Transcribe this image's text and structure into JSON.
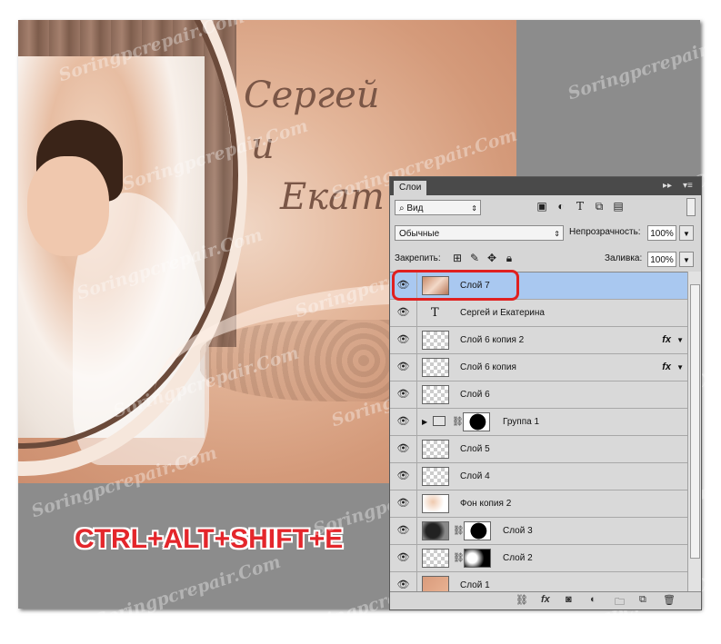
{
  "artwork": {
    "names_line1": "Сергей",
    "names_line2": "и",
    "names_line3": "Екат",
    "shortcut_caption": "CTRL+ALT+SHIFT+E",
    "watermark": "Soringpcrepair.Com"
  },
  "panel": {
    "tab_label": "Слои",
    "collapse_glyph": "▸▸",
    "menu_glyph": "▾≡",
    "filter_kind": "Вид",
    "blend_mode": "Обычные",
    "opacity_label": "Непрозрачность:",
    "opacity_value": "100%",
    "lock_label": "Закрепить:",
    "fill_label": "Заливка:",
    "fill_value": "100%",
    "fx_label": "fx"
  },
  "layers": [
    {
      "name": "Слой 7",
      "thumb": "photo",
      "selected": true
    },
    {
      "name": "Сергей и Екатерина",
      "type": "text"
    },
    {
      "name": "Слой 6 копия 2",
      "thumb": "transparent",
      "fx": true
    },
    {
      "name": "Слой 6 копия",
      "thumb": "transparent",
      "fx": true
    },
    {
      "name": "Слой 6",
      "thumb": "transparent"
    },
    {
      "name": "Группа 1",
      "type": "group",
      "mask": "black"
    },
    {
      "name": "Слой 5",
      "thumb": "transparent"
    },
    {
      "name": "Слой 4",
      "thumb": "transparent"
    },
    {
      "name": "Фон копия 2",
      "thumb": "bride"
    },
    {
      "name": "Слой 3",
      "thumb": "dark",
      "mask": "black"
    },
    {
      "name": "Слой 2",
      "thumb": "transparent",
      "mask": "gradient"
    },
    {
      "name": "Слой 1",
      "thumb": "peach"
    }
  ]
}
